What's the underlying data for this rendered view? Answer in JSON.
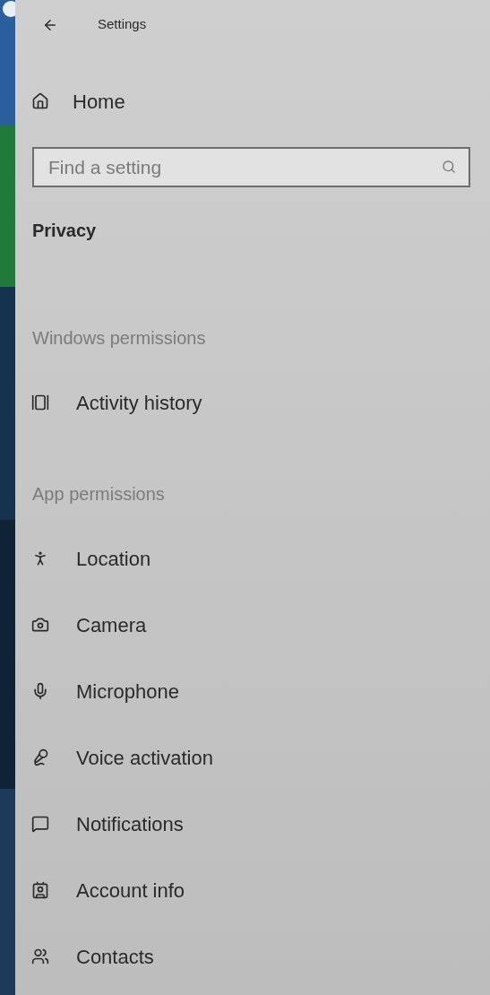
{
  "window": {
    "title": "Settings"
  },
  "home": {
    "label": "Home"
  },
  "search": {
    "placeholder": "Find a setting"
  },
  "section_title": "Privacy",
  "groups": [
    {
      "heading": "Windows permissions",
      "items": [
        {
          "label": "Activity history"
        }
      ]
    },
    {
      "heading": "App permissions",
      "items": [
        {
          "label": "Location"
        },
        {
          "label": "Camera"
        },
        {
          "label": "Microphone"
        },
        {
          "label": "Voice activation"
        },
        {
          "label": "Notifications"
        },
        {
          "label": "Account info"
        },
        {
          "label": "Contacts"
        }
      ]
    }
  ]
}
